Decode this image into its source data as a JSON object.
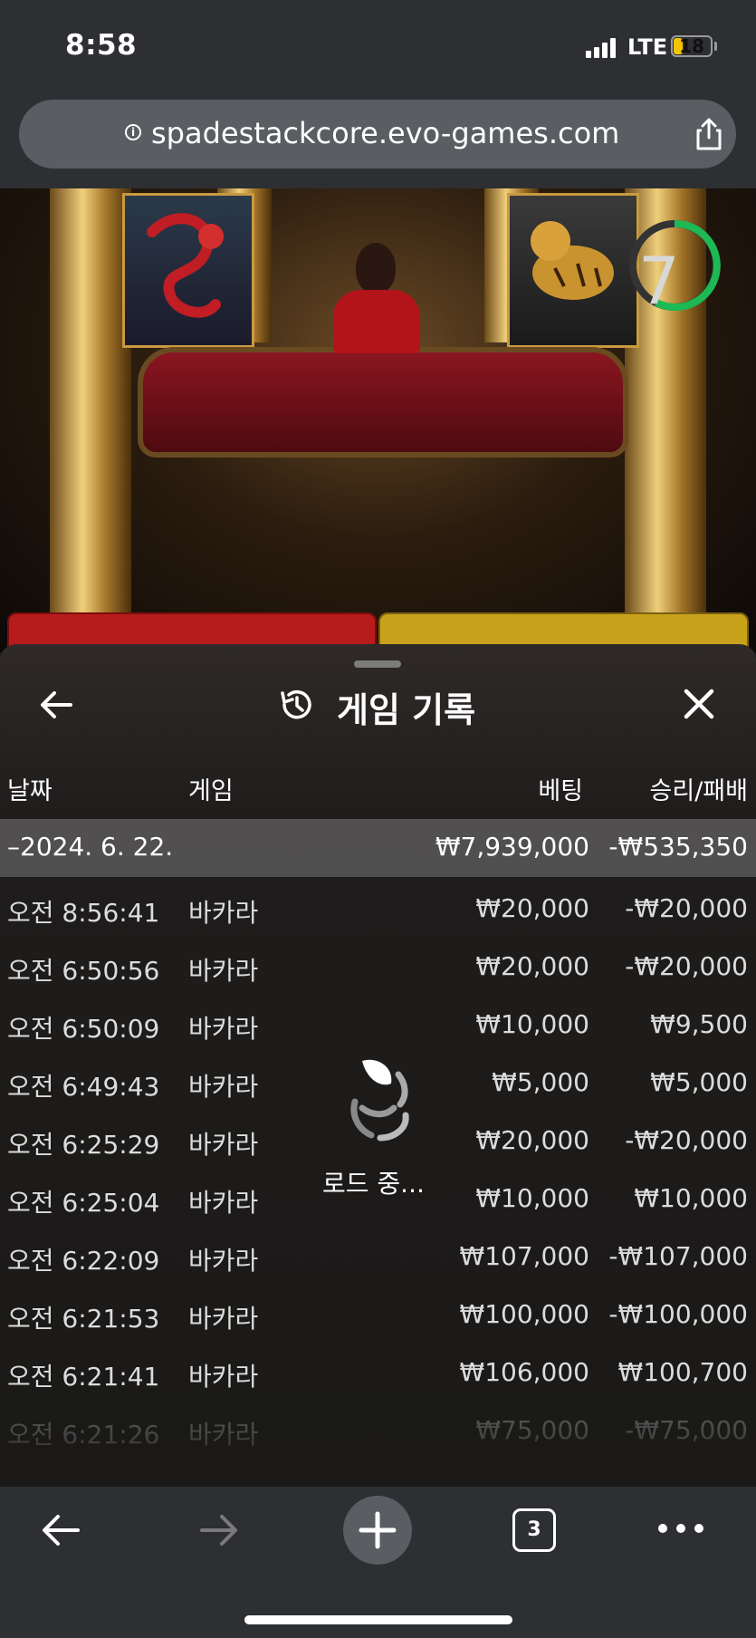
{
  "status_bar": {
    "time": "8:58",
    "network": "LTE",
    "battery": "18"
  },
  "browser": {
    "url": "spadestackcore.evo-games.com",
    "tab_count": "3"
  },
  "game": {
    "timer": "7"
  },
  "history": {
    "title": "게임 기록",
    "columns": {
      "date": "날짜",
      "game": "게임",
      "bet": "베팅",
      "winloss": "승리/패배"
    },
    "group": {
      "date": "–2024. 6. 22.",
      "bet": "₩7,939,000",
      "winloss": "-₩535,350"
    },
    "rows": [
      {
        "time": "오전 8:56:41",
        "game": "바카라",
        "bet": "₩20,000",
        "winloss": "-₩20,000"
      },
      {
        "time": "오전 6:50:56",
        "game": "바카라",
        "bet": "₩20,000",
        "winloss": "-₩20,000"
      },
      {
        "time": "오전 6:50:09",
        "game": "바카라",
        "bet": "₩10,000",
        "winloss": "₩9,500"
      },
      {
        "time": "오전 6:49:43",
        "game": "바카라",
        "bet": "₩5,000",
        "winloss": "₩5,000"
      },
      {
        "time": "오전 6:25:29",
        "game": "바카라",
        "bet": "₩20,000",
        "winloss": "-₩20,000"
      },
      {
        "time": "오전 6:25:04",
        "game": "바카라",
        "bet": "₩10,000",
        "winloss": "₩10,000"
      },
      {
        "time": "오전 6:22:09",
        "game": "바카라",
        "bet": "₩107,000",
        "winloss": "-₩107,000"
      },
      {
        "time": "오전 6:21:53",
        "game": "바카라",
        "bet": "₩100,000",
        "winloss": "-₩100,000"
      },
      {
        "time": "오전 6:21:41",
        "game": "바카라",
        "bet": "₩106,000",
        "winloss": "₩100,700"
      },
      {
        "time": "오전 6:21:26",
        "game": "바카라",
        "bet": "₩75,000",
        "winloss": "-₩75,000"
      }
    ],
    "loading_text": "로드 중..."
  },
  "colors": {
    "dragon": "#b71c1c",
    "tiger": "#c9a21b",
    "timer_ring": "#1db954",
    "battery_low": "#f5c400"
  }
}
